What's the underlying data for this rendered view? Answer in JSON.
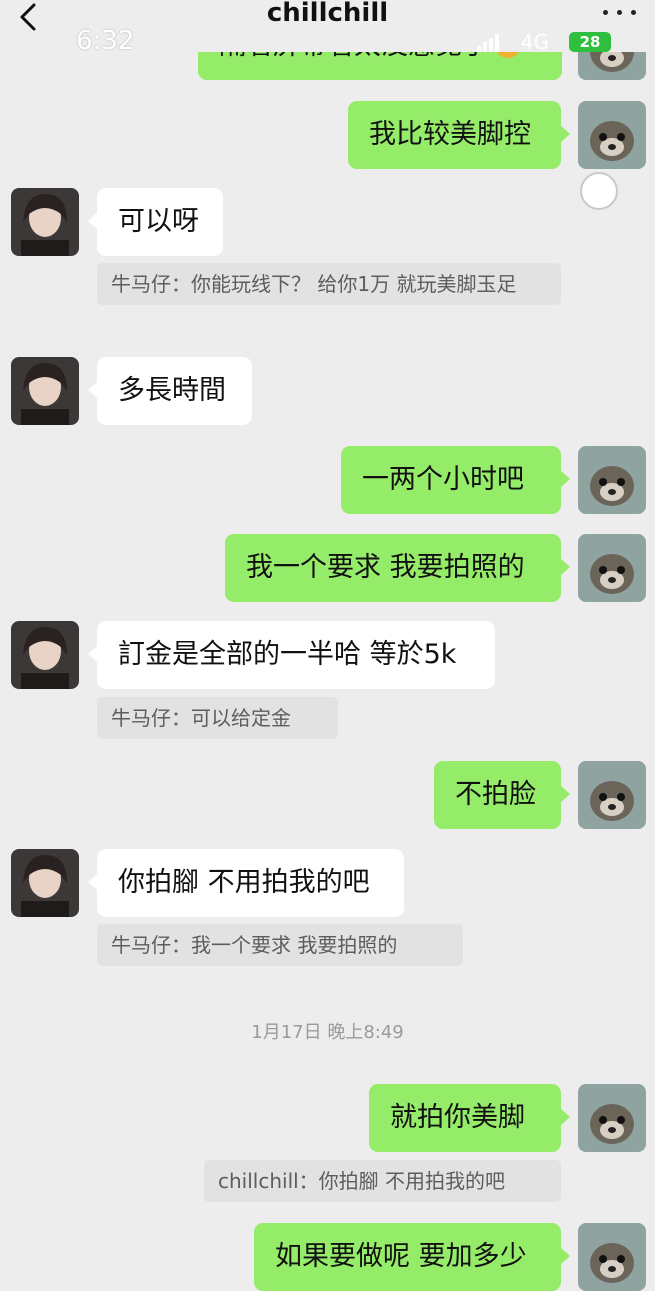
{
  "header": {
    "title": "chillchill",
    "status_time": "6:32",
    "network": "4G",
    "battery": "28"
  },
  "messages": {
    "m0_text": "隔着屏幕看太没感觉了",
    "m1_text": "我比较美脚控",
    "m2_text": "可以呀",
    "m2_quote": "牛马仔：你能玩线下？ 给你1万  就玩美脚玉足",
    "m3_text": "多長時間",
    "m4_text": "一两个小时吧",
    "m5_text": "我一个要求 我要拍照的",
    "m6_text": "訂金是全部的一半哈 等於5k",
    "m6_quote": "牛马仔：可以给定金",
    "m7_text": "不拍脸",
    "m8_text": "你拍腳 不用拍我的吧",
    "m8_quote": "牛马仔：我一个要求 我要拍照的",
    "timestamp": "1月17日 晚上8:49",
    "m9_text": "就拍你美脚",
    "m9_quote": "chillchill：你拍腳 不用拍我的吧",
    "m10_text": "如果要做呢 要加多少"
  },
  "colors": {
    "sent_bubble": "#95ec69",
    "received_bubble": "#ffffff",
    "background": "#ededed",
    "quote_bg": "#e2e2e2"
  },
  "icons": [
    "back-arrow-icon",
    "more-dots-icon",
    "signal-icon",
    "battery-icon",
    "emoji-icon"
  ]
}
